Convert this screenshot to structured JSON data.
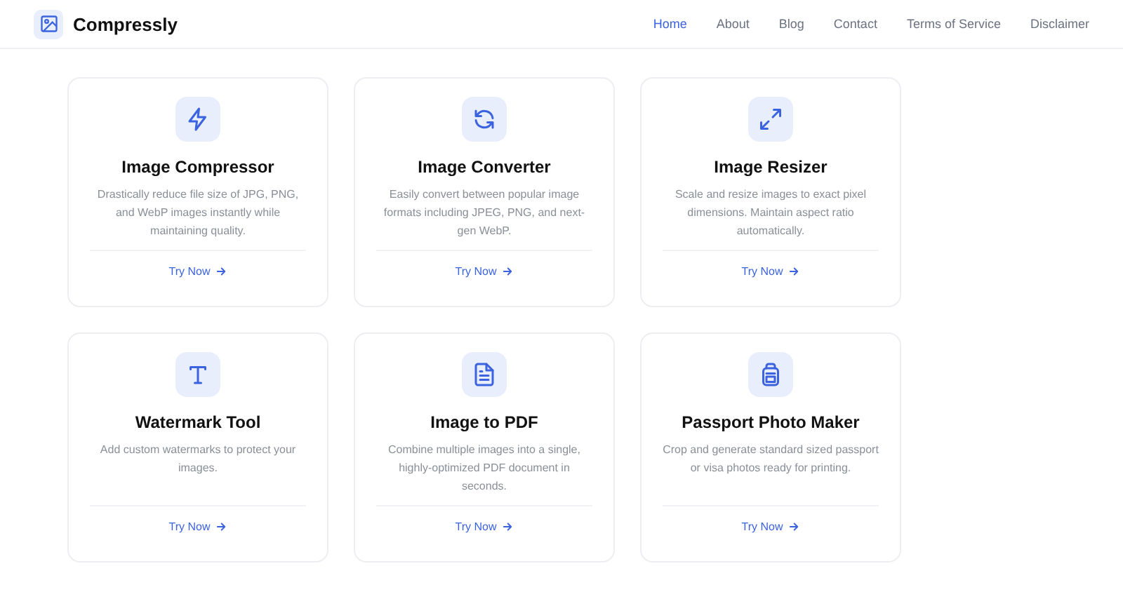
{
  "brand": "Compressly",
  "nav": [
    {
      "label": "Home",
      "selected": true
    },
    {
      "label": "About",
      "selected": false
    },
    {
      "label": "Blog",
      "selected": false
    },
    {
      "label": "Contact",
      "selected": false
    },
    {
      "label": "Terms of Service",
      "selected": false
    },
    {
      "label": "Disclaimer",
      "selected": false
    }
  ],
  "tools": [
    {
      "title": "Image Compressor",
      "description": "Drastically reduce file size of JPG, PNG, and WebP images instantly while maintaining quality.",
      "link": "Try Now"
    },
    {
      "title": "Image Converter",
      "description": "Easily convert between popular image formats including JPEG, PNG, and next-gen WebP.",
      "link": "Try Now"
    },
    {
      "title": "Image Resizer",
      "description": "Scale and resize images to exact pixel dimensions. Maintain aspect ratio automatically.",
      "link": "Try Now"
    },
    {
      "title": "Watermark Tool",
      "description": "Add custom watermarks to protect your images.",
      "link": "Try Now"
    },
    {
      "title": "Image to PDF",
      "description": "Combine multiple images into a single, highly-optimized PDF document in seconds.",
      "link": "Try Now"
    },
    {
      "title": "Passport Photo Maker",
      "description": "Crop and generate standard sized passport or visa photos ready for printing.",
      "link": "Try Now"
    }
  ]
}
